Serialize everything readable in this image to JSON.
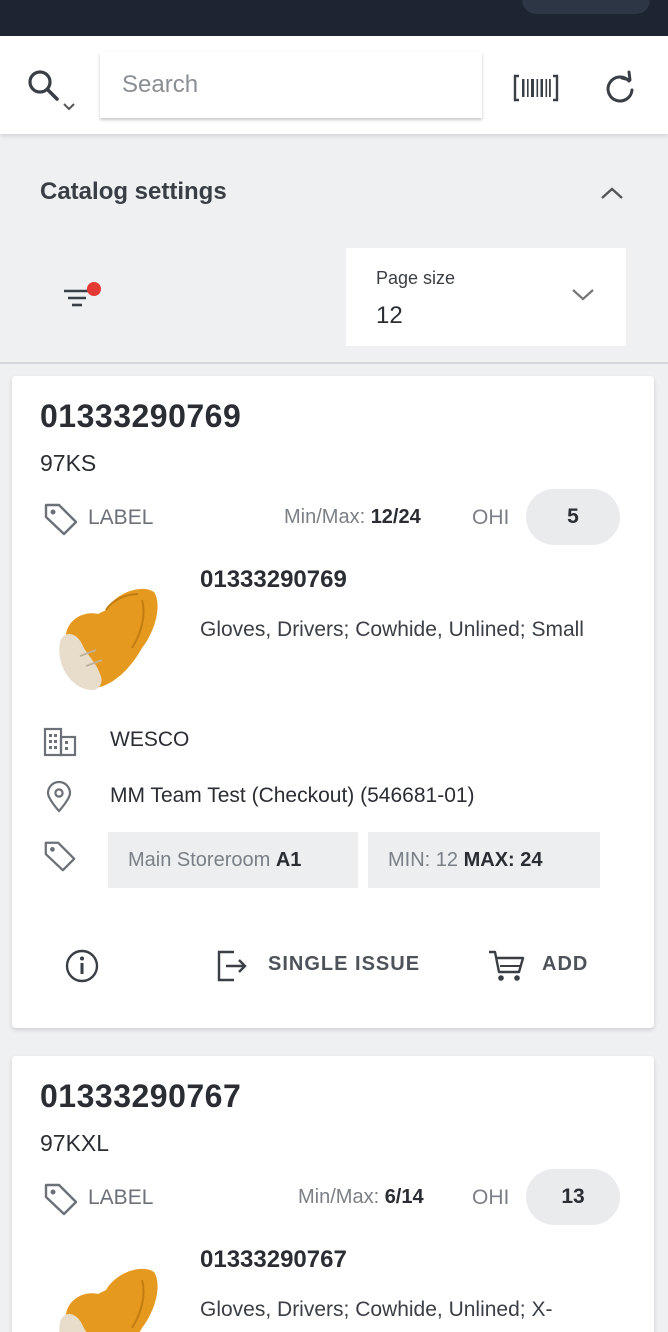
{
  "search": {
    "placeholder": "Search"
  },
  "catalog_settings": {
    "title": "Catalog settings",
    "page_size_label": "Page size",
    "page_size_value": "12"
  },
  "items": [
    {
      "part_number": "01333290769",
      "sub_code": "97KS",
      "label": "LABEL",
      "minmax_label": "Min/Max:",
      "minmax_value": "12/24",
      "ohi_label": "OHI",
      "ohi_value": "5",
      "item_number": "01333290769",
      "description": "Gloves, Drivers; Cowhide, Unlined; Small",
      "supplier": "WESCO",
      "location": "MM Team Test (Checkout) (546681-01)",
      "storeroom_label": "Main Storeroom",
      "storeroom_bin": "A1",
      "min_label": "MIN: 12",
      "max_label": "MAX: 24",
      "single_issue_label": "SINGLE ISSUE",
      "add_label": "ADD"
    },
    {
      "part_number": "01333290767",
      "sub_code": "97KXL",
      "label": "LABEL",
      "minmax_label": "Min/Max:",
      "minmax_value": "6/14",
      "ohi_label": "OHI",
      "ohi_value": "13",
      "item_number": "01333290767",
      "description": "Gloves, Drivers; Cowhide, Unlined; X-"
    }
  ],
  "colors": {
    "topbar": "#1c2531",
    "filter_badge": "#e53935",
    "glove": "#e59a1f"
  },
  "icons": [
    "search-icon",
    "barcode-icon",
    "refresh-icon",
    "chevron-up-icon",
    "filter-icon",
    "chevron-down-icon",
    "tag-icon",
    "building-icon",
    "location-pin-icon",
    "info-icon",
    "exit-icon",
    "cart-icon"
  ]
}
